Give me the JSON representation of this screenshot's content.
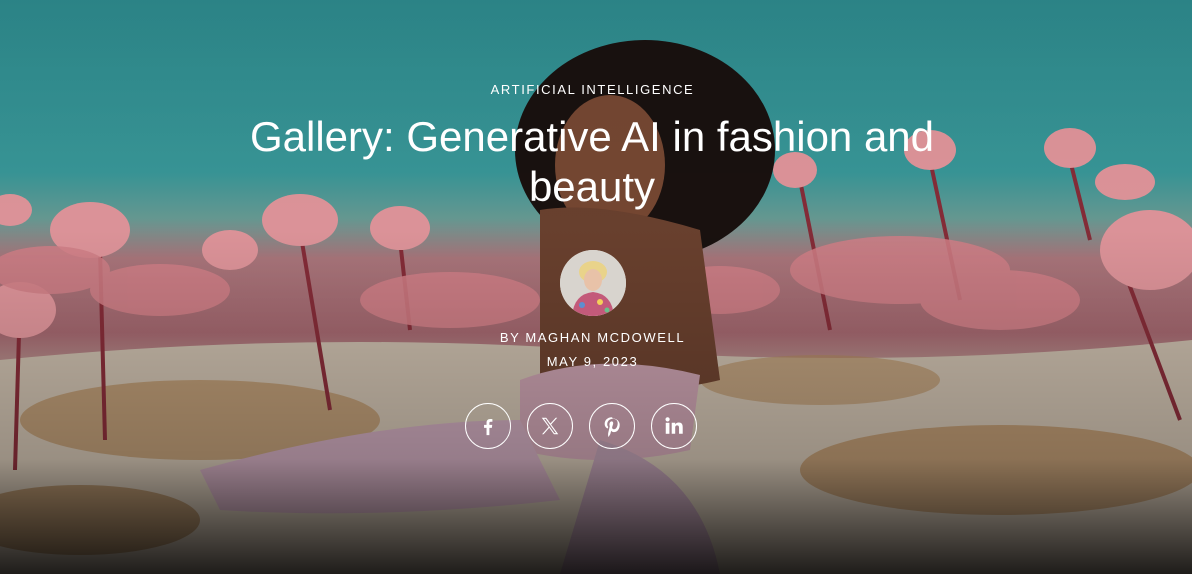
{
  "article": {
    "category": "ARTIFICIAL INTELLIGENCE",
    "title": "Gallery: Generative AI in fashion and beauty",
    "byline": "BY MAGHAN MCDOWELL",
    "date": "MAY 9, 2023"
  },
  "share": [
    {
      "icon": "facebook-icon"
    },
    {
      "icon": "x-icon"
    },
    {
      "icon": "pinterest-icon"
    },
    {
      "icon": "linkedin-icon"
    }
  ],
  "colors": {
    "sky": "#3a9c9d",
    "flowers": "#e79aa0",
    "text": "#ffffff"
  }
}
